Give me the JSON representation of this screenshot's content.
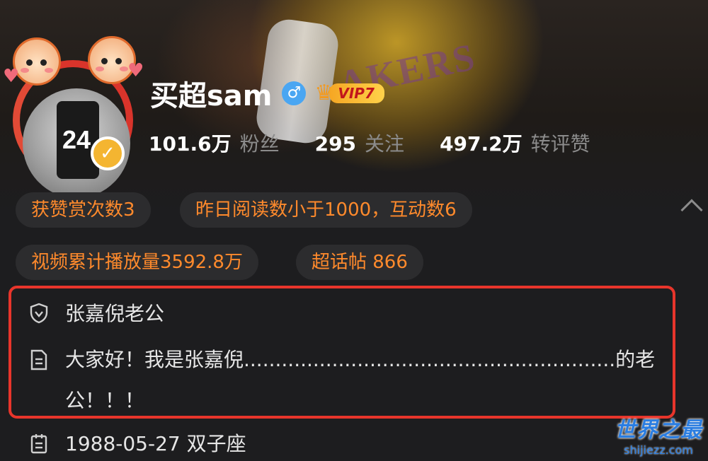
{
  "profile": {
    "name": "买超sam",
    "gender_icon": "male-icon",
    "vip_label": "VIP7",
    "avatar_number": "24"
  },
  "stats": [
    {
      "value": "101.6万",
      "label": "粉丝"
    },
    {
      "value": "295",
      "label": "关注"
    },
    {
      "value": "497.2万",
      "label": "转评赞"
    }
  ],
  "tags": [
    "获赞赏次数3",
    "昨日阅读数小于1000，互动数6",
    "视频累计播放量3592.8万",
    "超话帖 866"
  ],
  "info": {
    "verification": "张嘉倪老公",
    "bio": "大家好！我是张嘉倪...........................................................的老公！！！",
    "birthday": "1988-05-27 双子座"
  },
  "cover": {
    "jersey_text": "AKERS"
  },
  "watermark": {
    "main": "世界之最",
    "sub": "shijiezz.com"
  },
  "colors": {
    "accent_orange": "#ff8a2c",
    "highlight_red": "#e8352b",
    "verify_yellow": "#f4b531",
    "gender_blue": "#4aa6f2",
    "background": "#1d1d1f"
  }
}
